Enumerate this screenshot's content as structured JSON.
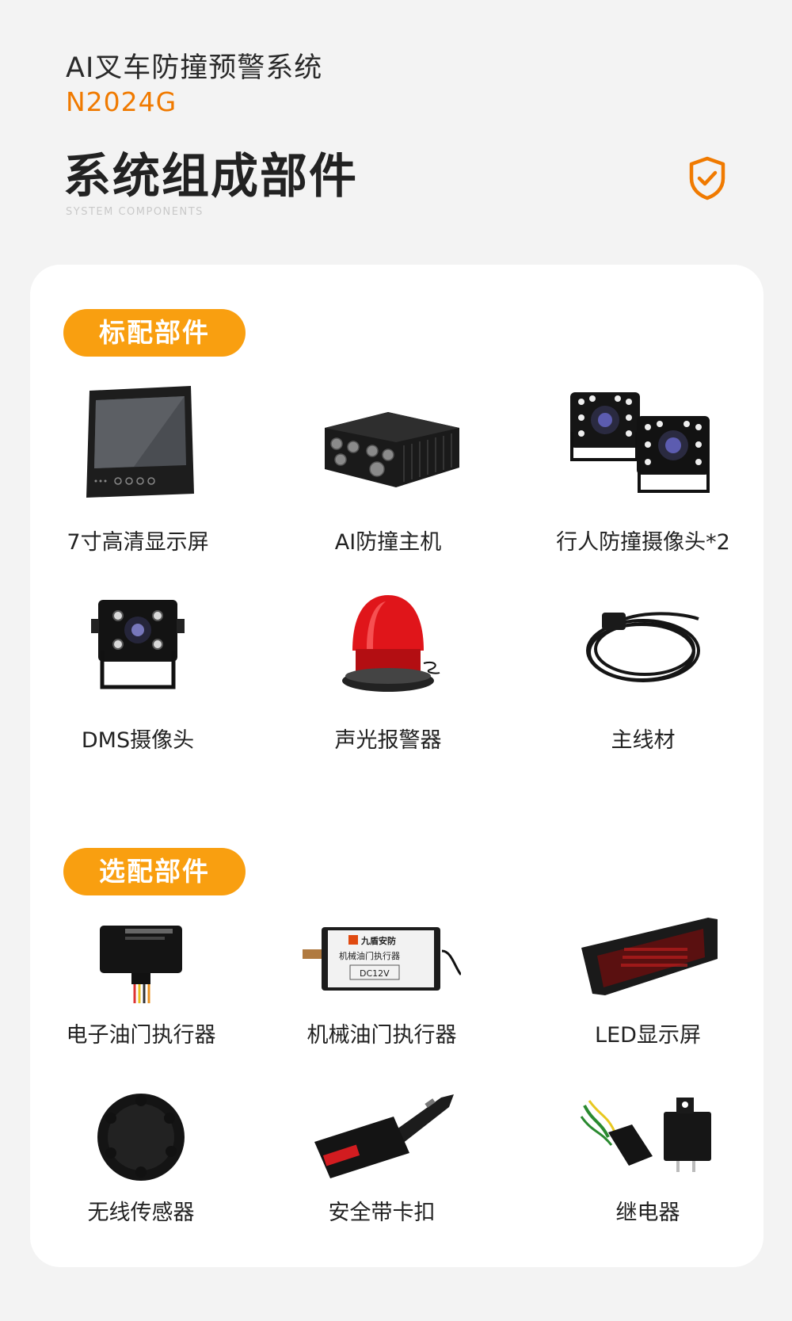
{
  "header": {
    "product_name": "AI叉车防撞预警系统",
    "model": "N2024G",
    "section_title": "系统组成部件",
    "section_subtitle": "SYSTEM COMPONENTS"
  },
  "colors": {
    "accent": "#f07a00",
    "pill": "#f99f10",
    "card": "#ffffff",
    "background": "#f3f3f3"
  },
  "standard": {
    "heading": "标配部件",
    "items": [
      {
        "label": "7寸高清显示屏",
        "icon": "monitor-icon"
      },
      {
        "label": "AI防撞主机",
        "icon": "host-box-icon"
      },
      {
        "label": "行人防撞摄像头*2",
        "icon": "camera-pair-icon"
      },
      {
        "label": "DMS摄像头",
        "icon": "camera-icon"
      },
      {
        "label": "声光报警器",
        "icon": "alarm-light-icon"
      },
      {
        "label": "主线材",
        "icon": "cable-icon"
      }
    ]
  },
  "optional": {
    "heading": "选配部件",
    "items": [
      {
        "label": "电子油门执行器",
        "icon": "electronic-actuator-icon"
      },
      {
        "label": "机械油门执行器",
        "icon": "mechanical-actuator-icon",
        "brand": "九盾安防",
        "panel_text": "机械油门执行器",
        "voltage": "DC12V"
      },
      {
        "label": "LED显示屏",
        "icon": "led-panel-icon"
      },
      {
        "label": "无线传感器",
        "icon": "wireless-sensor-icon"
      },
      {
        "label": "安全带卡扣",
        "icon": "seatbelt-buckle-icon"
      },
      {
        "label": "继电器",
        "icon": "relay-icon"
      }
    ]
  }
}
